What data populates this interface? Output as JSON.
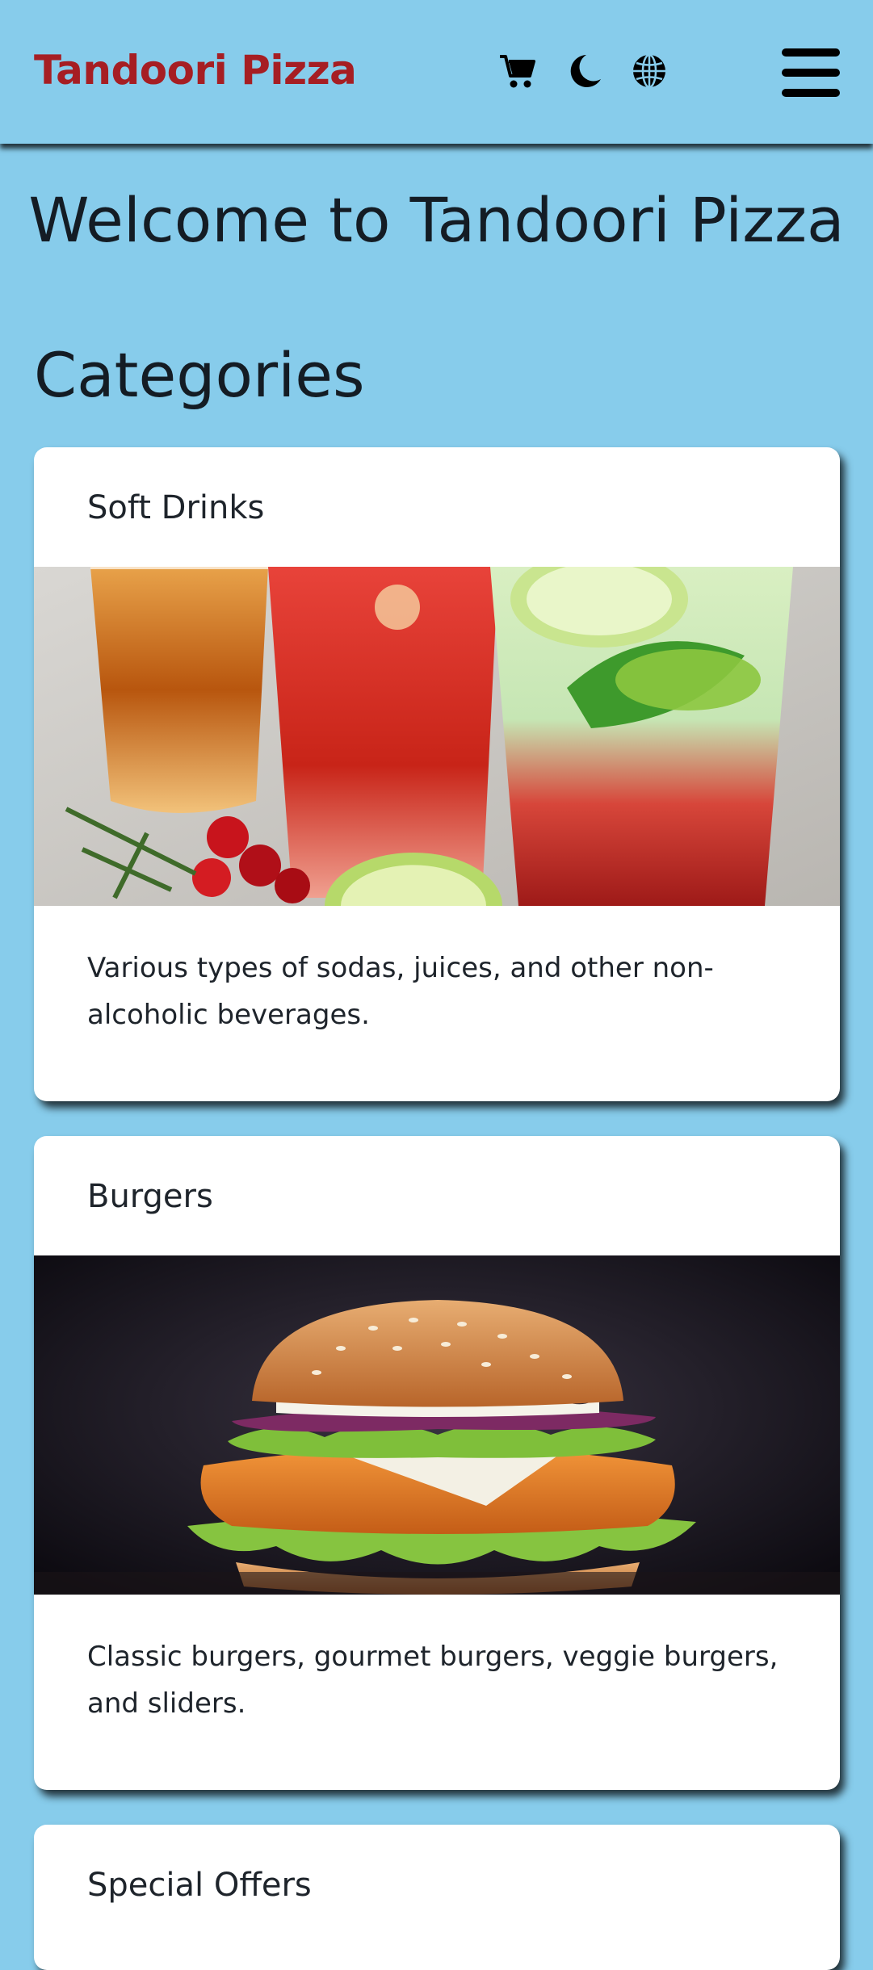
{
  "navbar": {
    "brand": "Tandoori Pizza",
    "brand_color": "#A61E23",
    "background": "#87CCEB",
    "icons": [
      "cart-icon",
      "moon-icon",
      "globe-icon",
      "hamburger-menu-icon"
    ]
  },
  "main": {
    "welcome": "Welcome to Tandoori Pizza",
    "categories_heading": "Categories",
    "categories": [
      {
        "title": "Soft Drinks",
        "image": "soft-drinks-photo",
        "description": "Various types of sodas, juices, and other non-alcoholic beverages."
      },
      {
        "title": "Burgers",
        "image": "burger-photo",
        "description": "Classic burgers, gourmet burgers, veggie burgers, and sliders."
      },
      {
        "title": "Special Offers"
      }
    ]
  }
}
